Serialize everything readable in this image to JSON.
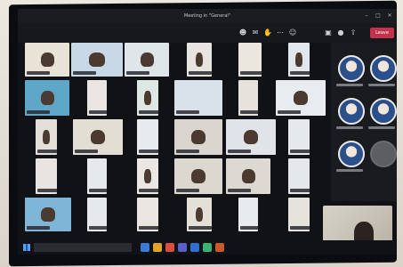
{
  "window": {
    "title": "Meeting in \"General\"",
    "controls": {
      "minimize": "–",
      "maximize": "□",
      "close": "✕"
    }
  },
  "toolbar": {
    "icons": [
      "people-icon",
      "chat-icon",
      "raise-hand-icon",
      "more-icon",
      "camera-icon",
      "mic-icon",
      "share-icon"
    ],
    "leave_label": "Leave"
  },
  "taskbar": {
    "search_placeholder": "",
    "time": "",
    "date": ""
  },
  "colors": {
    "leave": "#c4314b",
    "accent": "#4ea1ff",
    "chrome": "#17181c"
  }
}
